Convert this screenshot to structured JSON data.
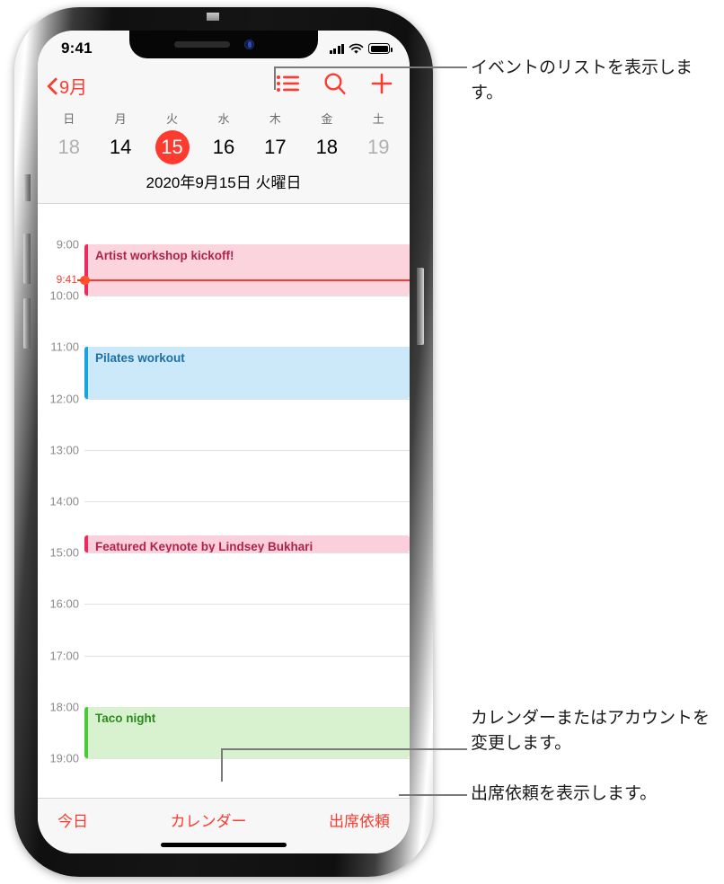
{
  "device": {
    "status_bar": {
      "time": "9:41",
      "cellular": "signal-bars-icon",
      "wifi": "wifi-icon",
      "battery": "battery-icon"
    }
  },
  "nav": {
    "back_label": "9月",
    "back_icon": "chevron-left-icon",
    "actions": [
      {
        "name": "list-view-icon",
        "label": "リスト"
      },
      {
        "name": "search-icon",
        "label": "検索"
      },
      {
        "name": "add-event-icon",
        "label": "追加"
      }
    ],
    "accent": "#ff3b30"
  },
  "week": {
    "weekdays": [
      "日",
      "月",
      "火",
      "水",
      "木",
      "金",
      "土"
    ],
    "dates": [
      {
        "num": "18",
        "state": "dim"
      },
      {
        "num": "14",
        "state": "normal"
      },
      {
        "num": "15",
        "state": "selected"
      },
      {
        "num": "16",
        "state": "normal"
      },
      {
        "num": "17",
        "state": "normal"
      },
      {
        "num": "18",
        "state": "normal"
      },
      {
        "num": "19",
        "state": "dim"
      }
    ],
    "full_date": "2020年9月15日 火曜日"
  },
  "day_view": {
    "hours": [
      "9:00",
      "10:00",
      "11:00",
      "12:00",
      "13:00",
      "14:00",
      "15:00",
      "16:00",
      "17:00",
      "18:00",
      "19:00"
    ],
    "current_time_label": "9:41",
    "events": [
      {
        "title": "Artist workshop kickoff!",
        "start": "9:00",
        "end": "10:00",
        "fill": "#fcd4de",
        "bar": "#ec2a5e",
        "text": "#b0234a"
      },
      {
        "title": "Pilates workout",
        "start": "11:00",
        "end": "12:00",
        "fill": "#cbe9f9",
        "bar": "#19a3e0",
        "text": "#1d6fa5"
      },
      {
        "title": "Featured Keynote by Lindsey Bukhari",
        "start": "14:40",
        "end": "15:00",
        "fill": "#fccfdd",
        "bar": "#ec2a5e",
        "text": "#b0234a"
      },
      {
        "title": "Taco night",
        "start": "18:00",
        "end": "19:00",
        "fill": "#d8f2cf",
        "bar": "#4bc93b",
        "text": "#2d8a1e"
      }
    ]
  },
  "toolbar": {
    "today_label": "今日",
    "calendar_label": "カレンダー",
    "invitations_label": "出席依頼"
  },
  "callouts": [
    {
      "id": "list",
      "text": "イベントのリストを表示します。"
    },
    {
      "id": "calendar",
      "text": "カレンダーまたはアカウントを変更します。"
    },
    {
      "id": "invitations",
      "text": "出席依頼を表示します。"
    }
  ]
}
